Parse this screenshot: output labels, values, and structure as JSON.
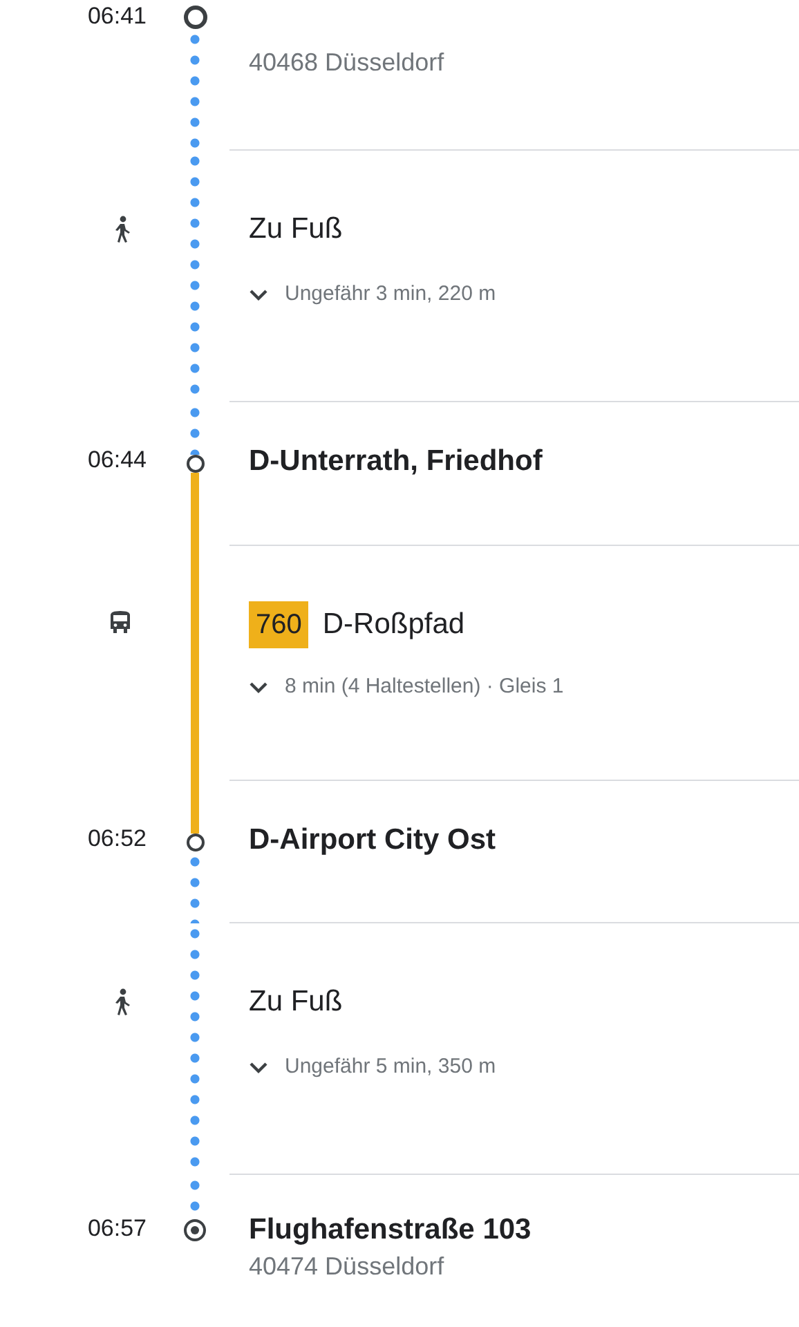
{
  "itinerary": [
    {
      "kind": "origin",
      "time": "06:41",
      "address": "40468 Düsseldorf"
    },
    {
      "kind": "walk",
      "title": "Zu Fuß",
      "detail": "Ungefähr 3 min, 220 m"
    },
    {
      "kind": "stop",
      "time": "06:44",
      "name": "D-Unterrath, Friedhof"
    },
    {
      "kind": "bus",
      "line": "760",
      "color": "#efb01a",
      "title": "D-Roßpfad",
      "detail": "8 min (4 Haltestellen) · Gleis 1"
    },
    {
      "kind": "stop",
      "time": "06:52",
      "name": "D-Airport City Ost"
    },
    {
      "kind": "walk",
      "title": "Zu Fuß",
      "detail": "Ungefähr 5 min, 350 m"
    },
    {
      "kind": "destination",
      "time": "06:57",
      "name": "Flughafenstraße 103",
      "address": "40474 Düsseldorf"
    }
  ]
}
